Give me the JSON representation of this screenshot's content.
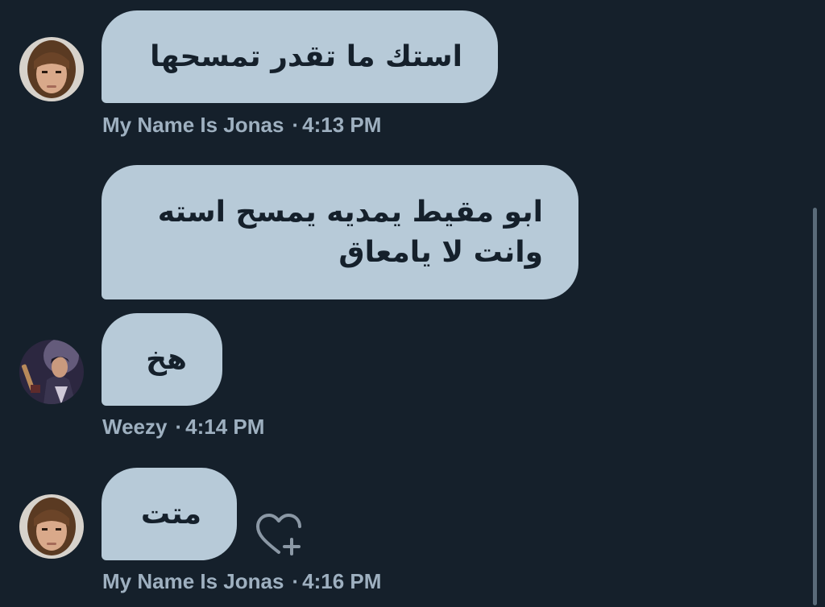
{
  "messages": [
    {
      "sender": "My Name Is Jonas",
      "time": "4:13 PM",
      "lines": [
        "استك ما تقدر تمسحها"
      ]
    },
    {
      "sender": "My Name Is Jonas",
      "time": "",
      "lines": [
        "ابو مقيط يمديه يمسح استه",
        "وانت لا يامعاق"
      ]
    },
    {
      "sender": "Weezy",
      "time": "4:14 PM",
      "lines": [
        "هخ"
      ]
    },
    {
      "sender": "My Name Is Jonas",
      "time": "4:16 PM",
      "lines": [
        "متت"
      ]
    }
  ],
  "separator": "·",
  "icons": {
    "reaction": "heart-plus-icon"
  },
  "colors": {
    "background": "#15202b",
    "bubble": "#b7cad8",
    "bubble_text": "#15202b",
    "meta_text": "#9eb0c0"
  }
}
